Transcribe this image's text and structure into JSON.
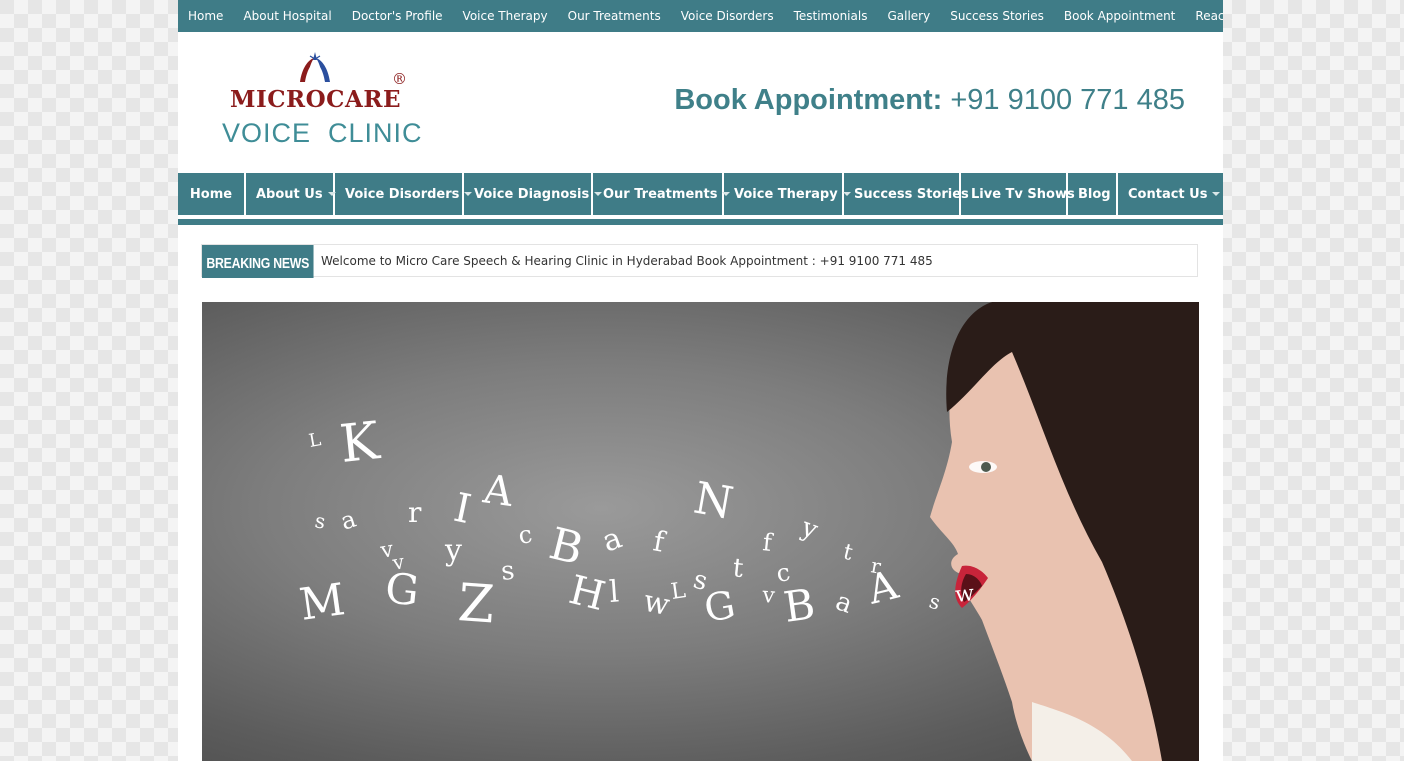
{
  "top_nav": [
    "Home",
    "About Hospital",
    "Doctor's Profile",
    "Voice Therapy",
    "Our Treatments",
    "Voice Disorders",
    "Testimonials",
    "Gallery",
    "Success Stories",
    "Book Appointment",
    "Reach Us"
  ],
  "logo": {
    "name": "MICROCARE",
    "registered": "®",
    "subtitle": "VOICE  CLINIC"
  },
  "header": {
    "book_label": "Book Appointment:",
    "phone": "+91 9100 771 485"
  },
  "main_nav": [
    {
      "label": "Home",
      "dropdown": false
    },
    {
      "label": "About Us",
      "dropdown": true
    },
    {
      "label": "Voice Disorders",
      "dropdown": true
    },
    {
      "label": "Voice Diagnosis",
      "dropdown": true
    },
    {
      "label": "Our Treatments",
      "dropdown": true
    },
    {
      "label": "Voice Therapy",
      "dropdown": true
    },
    {
      "label": "Success Stories",
      "dropdown": false
    },
    {
      "label": "Live Tv Shows",
      "dropdown": false
    },
    {
      "label": "Blog",
      "dropdown": false
    },
    {
      "label": "Contact Us",
      "dropdown": true
    }
  ],
  "breaking_news": {
    "label": "BREAKING NEWS",
    "text": "Welcome to Micro Care Speech & Hearing Clinic in Hyderabad Book Appointment : +91 9100 771 485"
  },
  "hero": {
    "letters": [
      "L",
      "K",
      "A",
      "I",
      "r",
      "a",
      "s",
      "N",
      "c",
      "B",
      "a",
      "f",
      "y",
      "f",
      "v",
      "y",
      "t",
      "r",
      "v",
      "M",
      "G",
      "Z",
      "s",
      "H",
      "l",
      "w",
      "L",
      "s",
      "t",
      "c",
      "G",
      "v",
      "B",
      "a",
      "A",
      "s",
      "w"
    ]
  },
  "colors": {
    "teal": "#3f7c87",
    "logo_red": "#8b1c1c",
    "logo_teal": "#3f8d97"
  }
}
